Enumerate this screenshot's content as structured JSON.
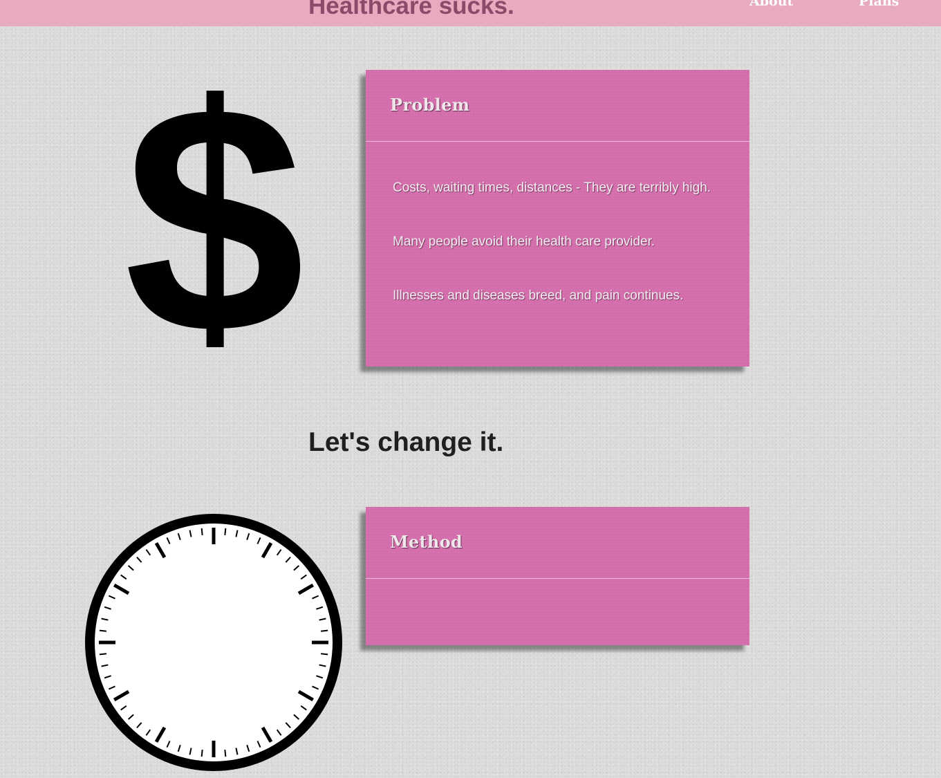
{
  "header": {
    "title": "Healthcare sucks.",
    "nav": [
      {
        "label": "About"
      },
      {
        "label": "Plans"
      }
    ]
  },
  "problem": {
    "title": "Problem",
    "lines": [
      "Costs, waiting times, distances - They are terribly high.",
      "Many people avoid their health care provider.",
      "Illnesses and diseases breed, and pain continues."
    ]
  },
  "cta": {
    "heading": "Let's change it."
  },
  "method": {
    "title": "Method"
  },
  "icons": {
    "problem_icon": "dollar-sign-icon",
    "method_icon": "clock-icon"
  },
  "colors": {
    "header_bg": "#e7aabf",
    "title_color": "#8a4a69",
    "card_bg": "#d36dab",
    "heading_color": "#1f1f1f"
  }
}
